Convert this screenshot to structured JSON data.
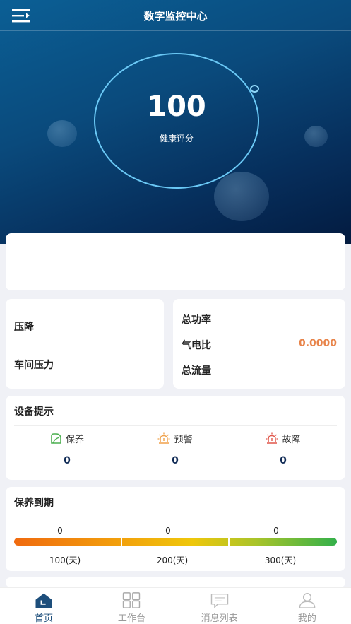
{
  "header": {
    "title": "数字监控中心"
  },
  "health": {
    "score": "100",
    "label": "健康评分"
  },
  "metrics_left": {
    "pressure_drop": "压降",
    "workshop_pressure": "车间压力"
  },
  "metrics_right": {
    "total_power": "总功率",
    "gas_power_ratio": "气电比",
    "gas_power_ratio_value": "0.0000",
    "total_flow": "总流量"
  },
  "device": {
    "title": "设备提示",
    "items": [
      {
        "label": "保养",
        "value": "0",
        "icon": "leaf-icon",
        "color": "#4caf50"
      },
      {
        "label": "预警",
        "value": "0",
        "icon": "warning-light-icon",
        "color": "#f0a14a"
      },
      {
        "label": "故障",
        "value": "0",
        "icon": "alarm-light-icon",
        "color": "#e0564a"
      }
    ]
  },
  "maintenance": {
    "title": "保养到期",
    "counts": [
      "0",
      "0",
      "0"
    ],
    "thresholds": [
      "100(天)",
      "200(天)",
      "300(天)"
    ]
  },
  "tabs": [
    {
      "label": "首页",
      "icon": "home-icon",
      "active": true
    },
    {
      "label": "工作台",
      "icon": "grid-icon",
      "active": false
    },
    {
      "label": "消息列表",
      "icon": "message-icon",
      "active": false
    },
    {
      "label": "我的",
      "icon": "user-icon",
      "active": false
    }
  ],
  "colors": {
    "accent": "#1d4e7b",
    "ratio_value": "#e8844a",
    "ring": "#6ac8f5"
  }
}
